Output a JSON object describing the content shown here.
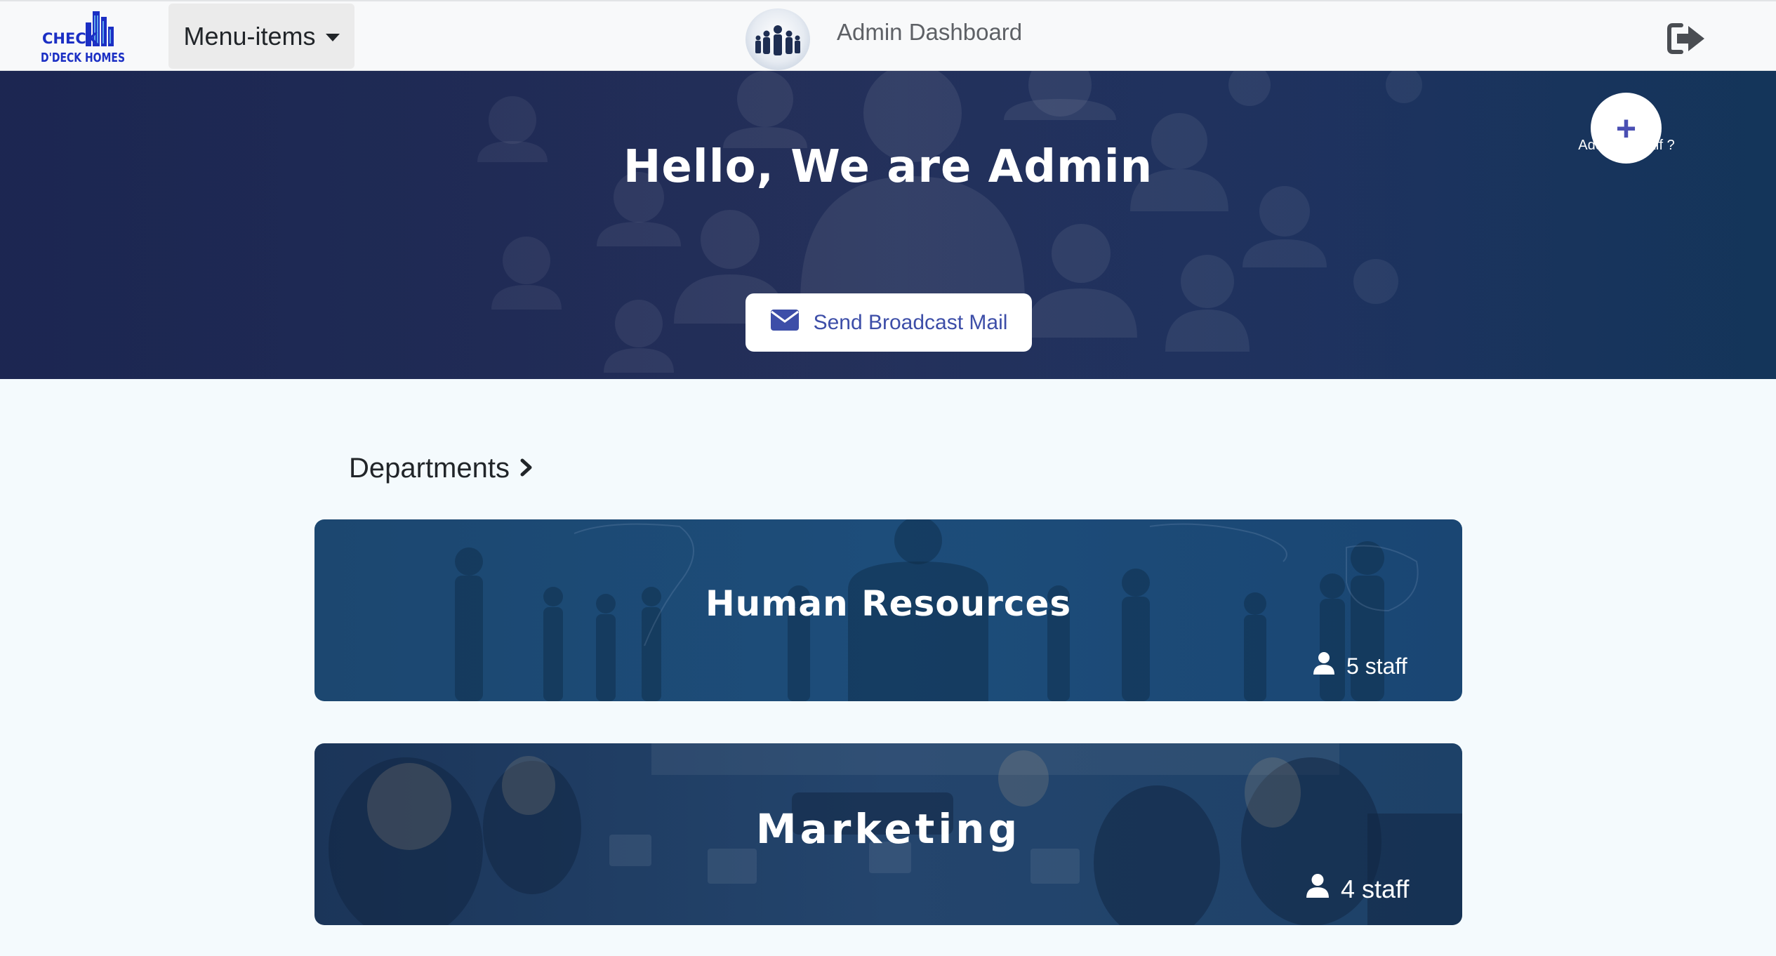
{
  "navbar": {
    "logo_text_line1": "CHECK",
    "logo_text_line2": "D'DECK HOMES",
    "menu_label": "Menu-items",
    "title": "Admin Dashboard"
  },
  "hero": {
    "title": "Hello, We are Admin",
    "broadcast_label": "Send Broadcast Mail",
    "add_staff_label": "Add new staff ?",
    "add_staff_symbol": "+"
  },
  "departments": {
    "heading": "Departments",
    "items": [
      {
        "name": "Human Resources",
        "staff": "5 staff"
      },
      {
        "name": "Marketing",
        "staff": "4 staff"
      }
    ]
  },
  "icons": {
    "logout": "logout-icon",
    "mail": "envelope-icon",
    "user": "user-icon",
    "chevron": "chevron-right-icon"
  },
  "colors": {
    "hero_bg": "#1d2853",
    "accent": "#3d4ea8",
    "logo_blue": "#1b2fc4",
    "navbar_bg": "#f8f9fa"
  }
}
